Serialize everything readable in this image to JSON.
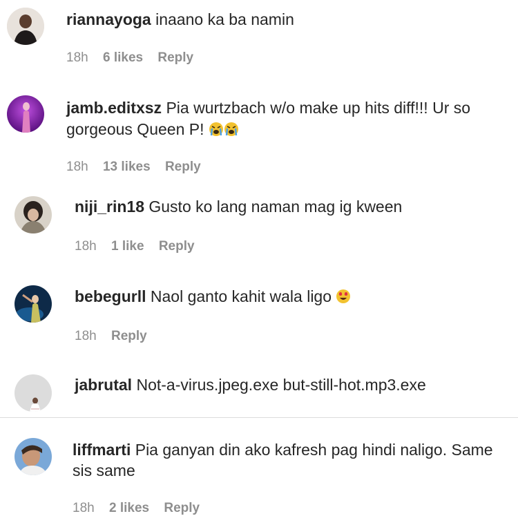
{
  "comments": [
    {
      "username": "riannayoga",
      "text": "inaano ka ba namin",
      "time": "18h",
      "likes": "6 likes",
      "reply": "Reply"
    },
    {
      "username": "jamb.editxsz",
      "text_line1": "Pia wurtzbach w/o make up hits diff!!! Ur so",
      "text_line2": "gorgeous Queen P!",
      "time": "18h",
      "likes": "13 likes",
      "reply": "Reply"
    },
    {
      "username": "niji_rin18",
      "text": "Gusto ko lang naman mag ig kween",
      "time": "18h",
      "likes": "1 like",
      "reply": "Reply"
    },
    {
      "username": "bebegurll",
      "text": "Naol ganto kahit wala ligo",
      "time": "18h",
      "reply": "Reply"
    },
    {
      "username": "jabrutal",
      "text": "Not-a-virus.jpeg.exe but-still-hot.mp3.exe"
    },
    {
      "username": "liffmarti",
      "text_line1": "Pia ganyan din ako kafresh pag hindi naligo. Same",
      "text_line2": "sis same",
      "time": "18h",
      "likes": "2 likes",
      "reply": "Reply"
    }
  ],
  "icons": {
    "crying_emoji": "loudly-crying-face",
    "heart_eyes_emoji": "smiling-face-with-heart-eyes"
  },
  "colors": {
    "text": "#262626",
    "meta": "#8e8e8e",
    "divider": "#dbdbdb"
  }
}
